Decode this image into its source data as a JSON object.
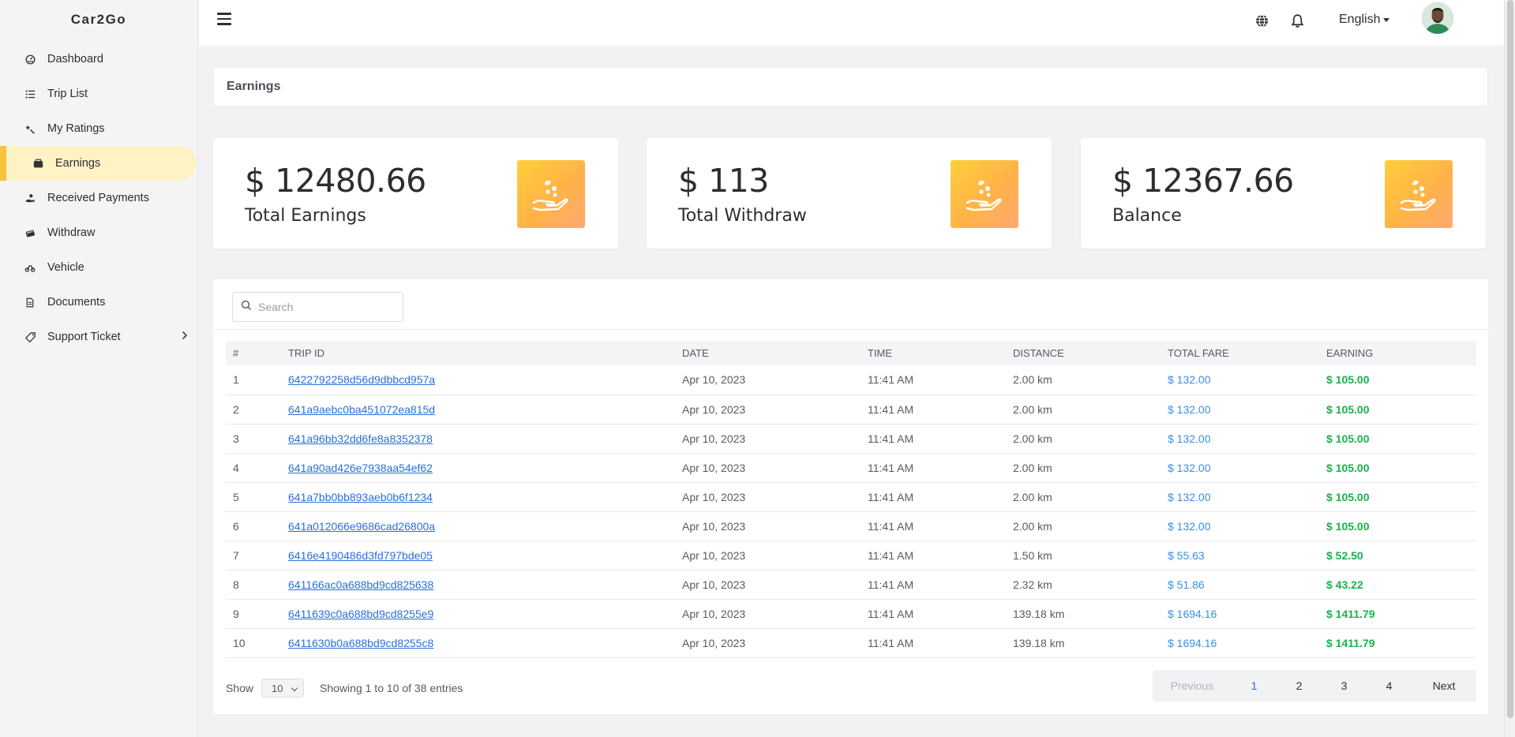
{
  "sidebar": {
    "brand": "Car2Go",
    "items": [
      {
        "label": "Dashboard",
        "icon": "dashboard-icon"
      },
      {
        "label": "Trip List",
        "icon": "list-icon"
      },
      {
        "label": "My Ratings",
        "icon": "star-icon"
      },
      {
        "label": "Earnings",
        "icon": "wallet-icon",
        "active": true
      },
      {
        "label": "Received Payments",
        "icon": "payment-icon"
      },
      {
        "label": "Withdraw",
        "icon": "withdraw-icon"
      },
      {
        "label": "Vehicle",
        "icon": "vehicle-icon"
      },
      {
        "label": "Documents",
        "icon": "document-icon"
      },
      {
        "label": "Support Ticket",
        "icon": "ticket-icon"
      }
    ]
  },
  "topbar": {
    "language": "English"
  },
  "page": {
    "title": "Earnings"
  },
  "cards": [
    {
      "amount": "$ 12480.66",
      "label": "Total Earnings"
    },
    {
      "amount": "$ 113",
      "label": "Total Withdraw"
    },
    {
      "amount": "$ 12367.66",
      "label": "Balance"
    }
  ],
  "search": {
    "placeholder": "Search"
  },
  "table": {
    "headers": [
      "#",
      "TRIP ID",
      "DATE",
      "TIME",
      "DISTANCE",
      "TOTAL FARE",
      "EARNING"
    ],
    "rows": [
      [
        "1",
        "6422792258d56d9dbbcd957a",
        "Apr 10, 2023",
        "11:41 AM",
        "2.00 km",
        "$ 132.00",
        "$ 105.00"
      ],
      [
        "2",
        "641a9aebc0ba451072ea815d",
        "Apr 10, 2023",
        "11:41 AM",
        "2.00 km",
        "$ 132.00",
        "$ 105.00"
      ],
      [
        "3",
        "641a96bb32dd6fe8a8352378",
        "Apr 10, 2023",
        "11:41 AM",
        "2.00 km",
        "$ 132.00",
        "$ 105.00"
      ],
      [
        "4",
        "641a90ad426e7938aa54ef62",
        "Apr 10, 2023",
        "11:41 AM",
        "2.00 km",
        "$ 132.00",
        "$ 105.00"
      ],
      [
        "5",
        "641a7bb0bb893aeb0b6f1234",
        "Apr 10, 2023",
        "11:41 AM",
        "2.00 km",
        "$ 132.00",
        "$ 105.00"
      ],
      [
        "6",
        "641a012066e9686cad26800a",
        "Apr 10, 2023",
        "11:41 AM",
        "2.00 km",
        "$ 132.00",
        "$ 105.00"
      ],
      [
        "7",
        "6416e4190486d3fd797bde05",
        "Apr 10, 2023",
        "11:41 AM",
        "1.50 km",
        "$ 55.63",
        "$ 52.50"
      ],
      [
        "8",
        "641166ac0a688bd9cd825638",
        "Apr 10, 2023",
        "11:41 AM",
        "2.32 km",
        "$ 51.86",
        "$ 43.22"
      ],
      [
        "9",
        "6411639c0a688bd9cd8255e9",
        "Apr 10, 2023",
        "11:41 AM",
        "139.18 km",
        "$ 1694.16",
        "$ 1411.79"
      ],
      [
        "10",
        "6411630b0a688bd9cd8255c8",
        "Apr 10, 2023",
        "11:41 AM",
        "139.18 km",
        "$ 1694.16",
        "$ 1411.79"
      ]
    ]
  },
  "footer": {
    "show_label": "Show",
    "page_size": "10",
    "entries_text": "Showing 1 to 10 of 38 entries",
    "pagination": {
      "previous": "Previous",
      "pages": [
        "1",
        "2",
        "3",
        "4"
      ],
      "current": "1",
      "next": "Next"
    }
  },
  "colors": {
    "accent": "#f9c23c",
    "active_bg": "#fff3c6",
    "link": "#2a6fdb",
    "fare": "#3b8fe8",
    "earning": "#19b24b"
  }
}
